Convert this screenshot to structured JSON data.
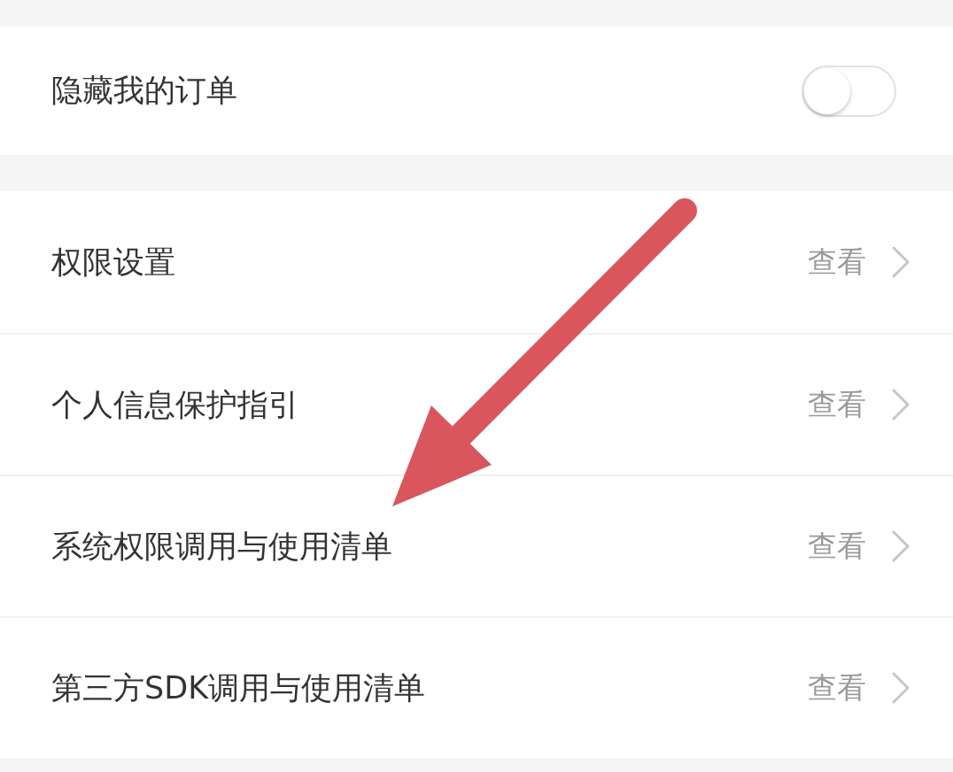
{
  "sections": [
    {
      "rows": [
        {
          "kind": "toggle",
          "label": "隐藏我的订单",
          "on": false
        }
      ]
    },
    {
      "rows": [
        {
          "kind": "link",
          "label": "权限设置",
          "action": "查看"
        },
        {
          "kind": "link",
          "label": "个人信息保护指引",
          "action": "查看"
        },
        {
          "kind": "link",
          "label": "系统权限调用与使用清单",
          "action": "查看"
        },
        {
          "kind": "link",
          "label": "第三方SDK调用与使用清单",
          "action": "查看"
        }
      ]
    }
  ],
  "annotation": {
    "kind": "arrow"
  }
}
